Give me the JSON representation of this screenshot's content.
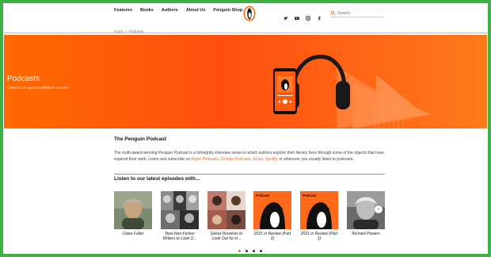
{
  "nav": {
    "items": [
      "Features",
      "Books",
      "Authors",
      "About Us",
      "Penguin Shop"
    ]
  },
  "search": {
    "placeholder": "Search"
  },
  "breadcrumb": {
    "home": "Home",
    "sep": ">",
    "current": "Podcasts"
  },
  "hero": {
    "title": "Podcasts",
    "subtitle": "Listen to our authors whatever you are"
  },
  "intro": {
    "title": "The Penguin Podcast",
    "text_1": "The multi-award-winning Penguin Podcast is a fortnightly interview series in which authors explore their literary lives through some of the objects that have inspired their work. Listen and subscribe on ",
    "link_apple": "Apple Podcasts",
    "comma_1": ", ",
    "link_google": "Google Podcasts",
    "comma_2": ", ",
    "link_acast": "Acast",
    "comma_3": ", ",
    "link_spotify": "Spotify",
    "text_2": ", or wherever you usually listen to podcasts."
  },
  "episodes": {
    "title": "Listen to our latest episodes with...",
    "podcast_label": "Podcast",
    "items": [
      {
        "caption": "Claire Fuller",
        "thumb": "photo"
      },
      {
        "caption": "New Non-Fiction Writers to Look O...",
        "thumb": "photo"
      },
      {
        "caption": "Debut Novelists to Look Out for in...",
        "thumb": "photo"
      },
      {
        "caption": "2021 in Review (Part 2)",
        "thumb": "podcast"
      },
      {
        "caption": "2021 in Review (Part 1)",
        "thumb": "podcast"
      },
      {
        "caption": "Richard Powers",
        "thumb": "photo"
      }
    ]
  },
  "carousel": {
    "next_glyph": "›",
    "dots": 4,
    "active_dot": 0
  },
  "colors": {
    "accent": "#ff6600",
    "frame": "#3cb043",
    "hero": "#ff5a0a"
  }
}
